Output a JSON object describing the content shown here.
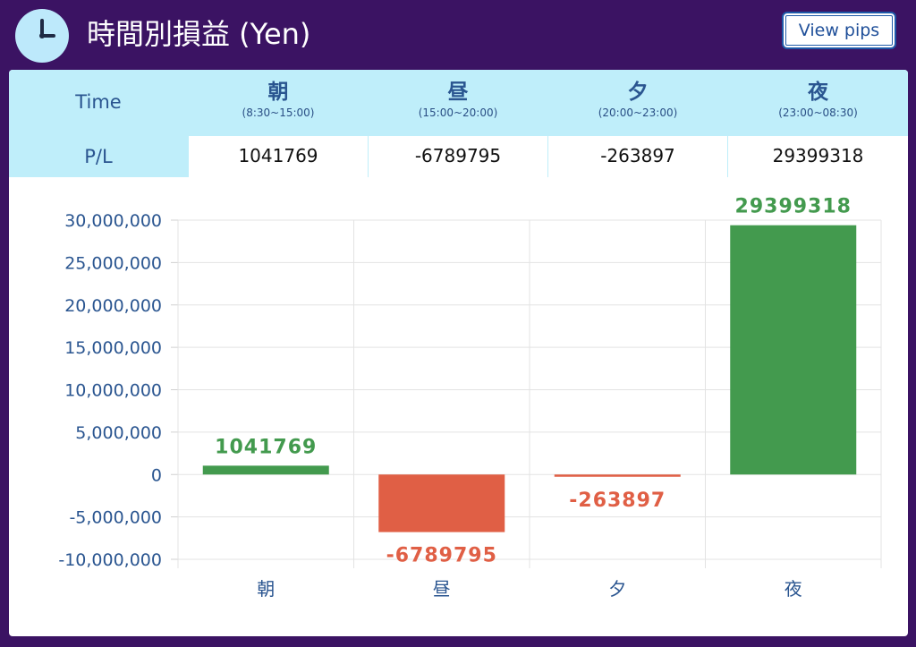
{
  "header": {
    "title": "時間別損益 (Yen)",
    "view_pips_label": "View pips",
    "clock_icon": "clock-icon"
  },
  "table": {
    "time_label": "Time",
    "pl_label": "P/L",
    "columns": [
      {
        "name": "朝",
        "range": "(8:30~15:00)",
        "value": "1041769"
      },
      {
        "name": "昼",
        "range": "(15:00~20:00)",
        "value": "-6789795"
      },
      {
        "name": "夕",
        "range": "(20:00~23:00)",
        "value": "-263897"
      },
      {
        "name": "夜",
        "range": "(23:00~08:30)",
        "value": "29399318"
      }
    ]
  },
  "colors": {
    "background": "#3b1363",
    "table_header": "#bfeefa",
    "positive": "#439a4e",
    "negative": "#e05f45",
    "axis_text": "#2a5590"
  },
  "chart_data": {
    "type": "bar",
    "categories": [
      "朝",
      "昼",
      "夕",
      "夜"
    ],
    "values": [
      1041769,
      -6789795,
      -263897,
      29399318
    ],
    "data_labels": [
      "1041769",
      "-6789795",
      "-263897",
      "29399318"
    ],
    "ylim": [
      -10000000,
      30000000
    ],
    "yticks": [
      -10000000,
      -5000000,
      0,
      5000000,
      10000000,
      15000000,
      20000000,
      25000000,
      30000000
    ],
    "ytick_labels": [
      "-10,000,000",
      "-5,000,000",
      "0",
      "5,000,000",
      "10,000,000",
      "15,000,000",
      "20,000,000",
      "25,000,000",
      "30,000,000"
    ],
    "grid": true,
    "legend": "none"
  }
}
